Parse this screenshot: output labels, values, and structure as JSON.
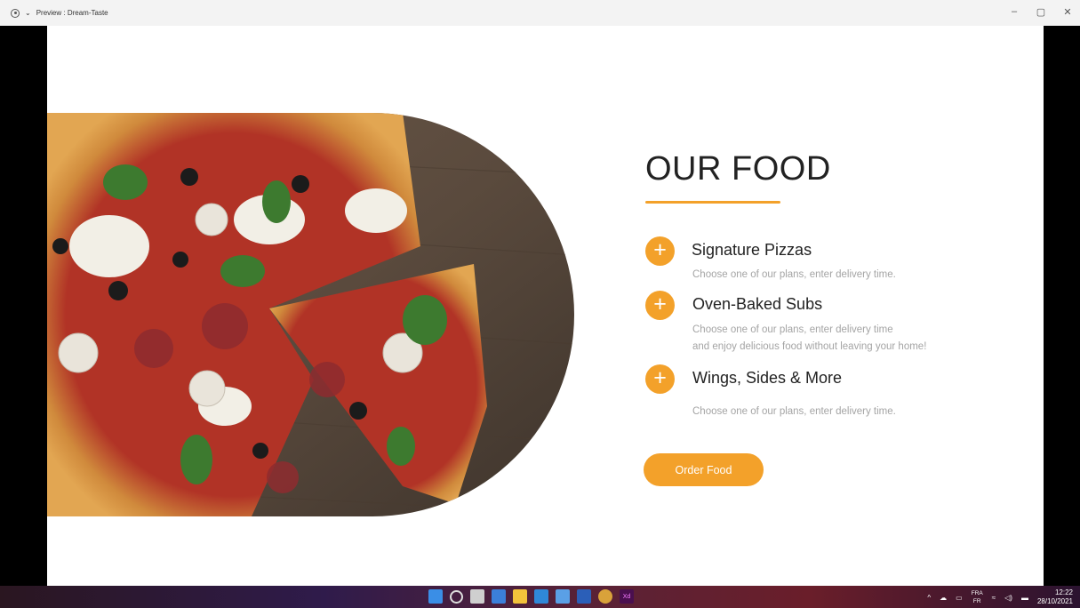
{
  "window": {
    "title": "Preview : Dream-Taste"
  },
  "section": {
    "heading": "OUR FOOD"
  },
  "items": [
    {
      "title": "Signature Pizzas",
      "desc_lines": [
        "Choose one of our plans, enter delivery time."
      ]
    },
    {
      "title": "Oven-Baked Subs",
      "desc_lines": [
        "Choose one of our plans, enter delivery time",
        "and enjoy delicious food without leaving your home!"
      ]
    },
    {
      "title": "Wings, Sides & More",
      "desc_lines": [
        "Choose one of our plans, enter delivery time."
      ]
    }
  ],
  "cta": {
    "label": "Order Food"
  },
  "colors": {
    "accent": "#f3a12a",
    "heading": "#222222",
    "muted": "#a4a4a4"
  },
  "taskbar": {
    "apps": [
      "start-icon",
      "search-icon",
      "taskview-icon",
      "widgets-icon",
      "file-explorer-icon",
      "vscode-icon",
      "notepad-icon",
      "word-icon",
      "chrome-icon",
      "xd-icon"
    ],
    "xd_label": "Xd",
    "lang_top": "FRA",
    "lang_bottom": "FR",
    "time": "12:22",
    "date": "28/10/2021"
  }
}
